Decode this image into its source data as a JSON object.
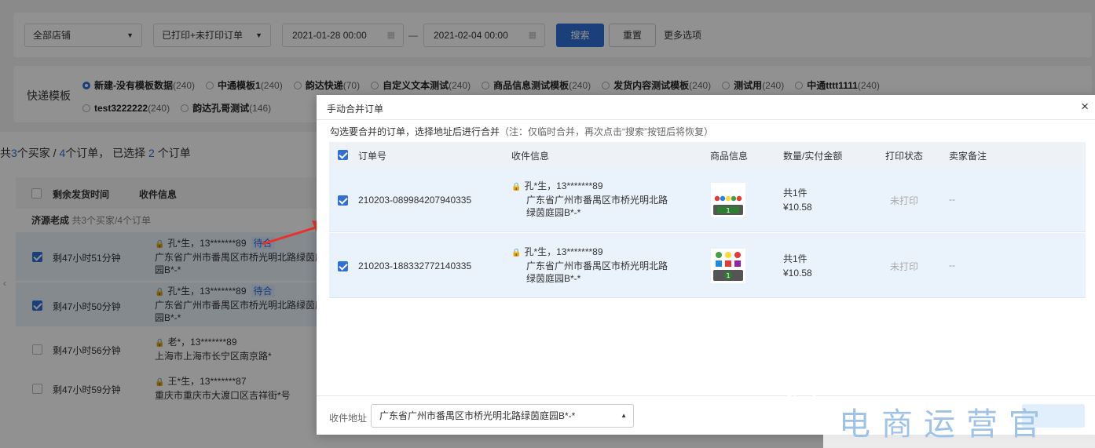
{
  "filters": {
    "shop_select": "全部店铺",
    "print_select": "已打印+未打印订单",
    "date_from": "2021-01-28 00:00",
    "date_sep": "—",
    "date_to": "2021-02-04 00:00",
    "search": "搜索",
    "reset": "重置",
    "more": "更多选项"
  },
  "templates": {
    "label": "快递模板",
    "row1": [
      {
        "name": "新建-没有模板数据",
        "count": "(240)",
        "selected": true
      },
      {
        "name": "中通模板1",
        "count": "(240)"
      },
      {
        "name": "韵达快递",
        "count": "(70)"
      },
      {
        "name": "自定义文本测试",
        "count": "(240)"
      },
      {
        "name": "商品信息测试模板",
        "count": "(240)"
      },
      {
        "name": "发货内容测试模板",
        "count": "(240)"
      },
      {
        "name": "测试用",
        "count": "(240)"
      },
      {
        "name": "中通tttt1111",
        "count": "(240)"
      }
    ],
    "row2": [
      {
        "name": "test3222222",
        "count": "(240)"
      },
      {
        "name": "韵达孔哥测试",
        "count": "(146)"
      }
    ]
  },
  "summary": {
    "prefix": "共",
    "buyers": "3",
    "mid1": "个买家 / ",
    "orders": "4",
    "mid2": "个订单， 已选择",
    "selected": "2",
    "suffix": "个订单"
  },
  "list": {
    "col_time": "剩余发货时间",
    "col_info": "收件信息",
    "shop": "济源老成",
    "shop_meta": "共3个买家/4个订单",
    "rows": [
      {
        "time": "剩47小时51分钟",
        "name": "孔*生，13*******89",
        "tag": "待合",
        "addr": "广东省广州市番禺区市桥光明北路绿茵庭园B*-*",
        "checked": true
      },
      {
        "time": "剩47小时50分钟",
        "name": "孔*生，13*******89",
        "tag": "待合",
        "addr": "广东省广州市番禺区市桥光明北路绿茵庭园B*-*",
        "checked": true
      },
      {
        "time": "剩47小时56分钟",
        "name": "老*，13*******89",
        "tag": "",
        "addr": "上海市上海市长宁区南京路*",
        "checked": false
      },
      {
        "time": "剩47小时59分钟",
        "name": "王*生，13*******87",
        "tag": "",
        "addr": "重庆市重庆市大渡口区吉祥街*号",
        "checked": false
      }
    ]
  },
  "modal": {
    "title": "手动合并订单",
    "close": "×",
    "hint": "勾选要合并的订单，选择地址后进行合并",
    "hint_note": "（注：仅临时合并，再次点击“搜索”按钮后将恢复）",
    "columns": [
      "订单号",
      "收件信息",
      "商品信息",
      "数量/实付金额",
      "打印状态",
      "卖家备注"
    ],
    "rows": [
      {
        "order_no": "210203-089984207940335",
        "name": "孔*生，13*******89",
        "addr1": "广东省广州市番禺区市桥光明北路",
        "addr2": "绿茵庭园B*-*",
        "qty": "共1件",
        "amount": "¥10.58",
        "print_status": "未打印",
        "memo": "--",
        "thumb_badge": "1"
      },
      {
        "order_no": "210203-188332772140335",
        "name": "孔*生，13*******89",
        "addr1": "广东省广州市番禺区市桥光明北路",
        "addr2": "绿茵庭园B*-*",
        "qty": "共1件",
        "amount": "¥10.58",
        "print_status": "未打印",
        "memo": "--",
        "thumb_badge": "1"
      }
    ],
    "footer_label": "收件地址",
    "footer_address": "广东省广州市番禺区市桥光明北路绿茵庭园B*-*"
  },
  "watermark": "电商运营官",
  "colors": {
    "primary": "#2f6fd6",
    "row_selected": "#eaf3fc",
    "arrow": "#e8322b"
  }
}
